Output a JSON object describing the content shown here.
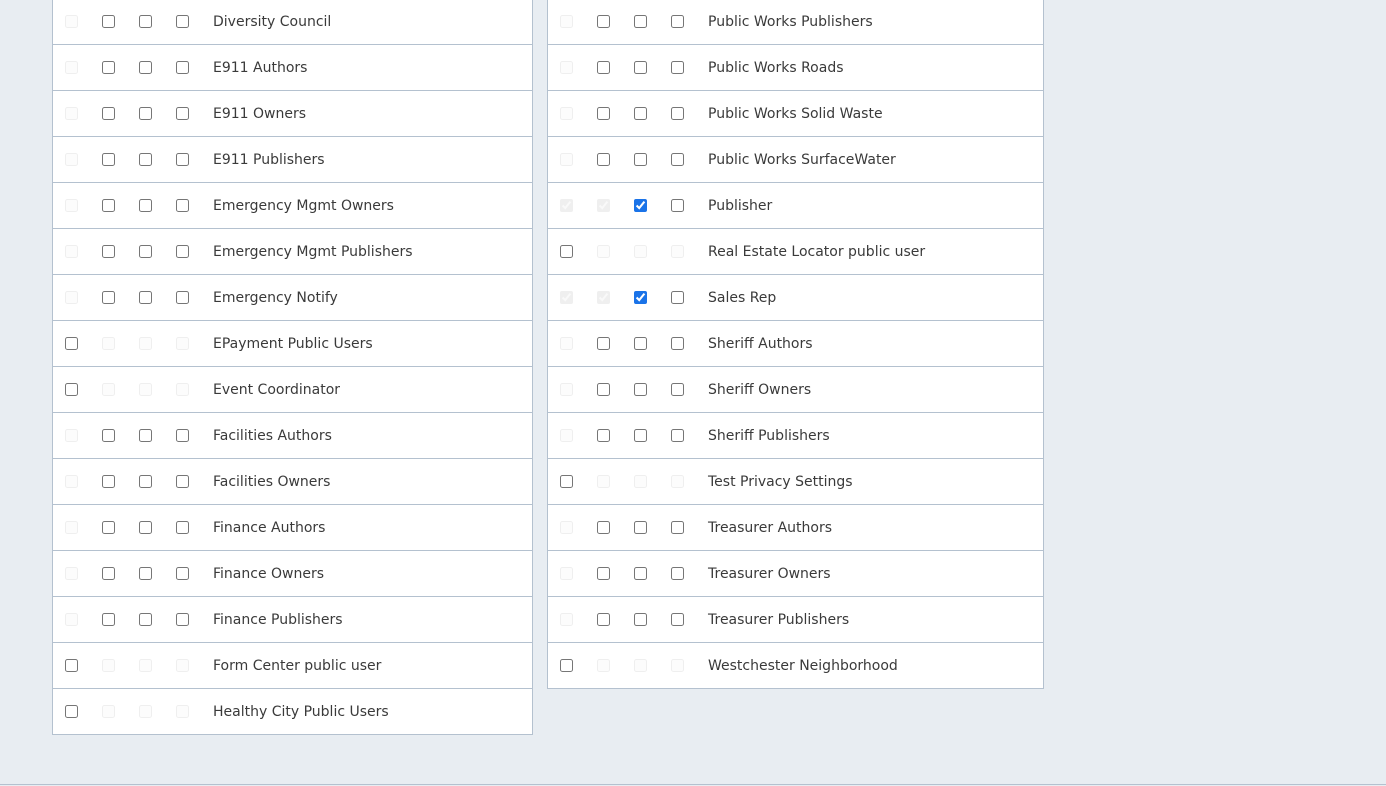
{
  "colors": {
    "page_background": "#e8edf2",
    "table_background": "#ffffff",
    "border": "#b4c1cf",
    "checkbox_checked": "#1a73e8",
    "text": "#3a3a3a"
  },
  "left_table": {
    "rows": [
      {
        "label": "Diversity Council",
        "checks": [
          {
            "checked": false,
            "disabled": true
          },
          {
            "checked": false,
            "disabled": false
          },
          {
            "checked": false,
            "disabled": false
          },
          {
            "checked": false,
            "disabled": false
          }
        ]
      },
      {
        "label": "E911 Authors",
        "checks": [
          {
            "checked": false,
            "disabled": true
          },
          {
            "checked": false,
            "disabled": false
          },
          {
            "checked": false,
            "disabled": false
          },
          {
            "checked": false,
            "disabled": false
          }
        ]
      },
      {
        "label": "E911 Owners",
        "checks": [
          {
            "checked": false,
            "disabled": true
          },
          {
            "checked": false,
            "disabled": false
          },
          {
            "checked": false,
            "disabled": false
          },
          {
            "checked": false,
            "disabled": false
          }
        ]
      },
      {
        "label": "E911 Publishers",
        "checks": [
          {
            "checked": false,
            "disabled": true
          },
          {
            "checked": false,
            "disabled": false
          },
          {
            "checked": false,
            "disabled": false
          },
          {
            "checked": false,
            "disabled": false
          }
        ]
      },
      {
        "label": "Emergency Mgmt Owners",
        "checks": [
          {
            "checked": false,
            "disabled": true
          },
          {
            "checked": false,
            "disabled": false
          },
          {
            "checked": false,
            "disabled": false
          },
          {
            "checked": false,
            "disabled": false
          }
        ]
      },
      {
        "label": "Emergency Mgmt Publishers",
        "checks": [
          {
            "checked": false,
            "disabled": true
          },
          {
            "checked": false,
            "disabled": false
          },
          {
            "checked": false,
            "disabled": false
          },
          {
            "checked": false,
            "disabled": false
          }
        ]
      },
      {
        "label": "Emergency Notify",
        "checks": [
          {
            "checked": false,
            "disabled": true
          },
          {
            "checked": false,
            "disabled": false
          },
          {
            "checked": false,
            "disabled": false
          },
          {
            "checked": false,
            "disabled": false
          }
        ]
      },
      {
        "label": "EPayment Public Users",
        "checks": [
          {
            "checked": false,
            "disabled": false
          },
          {
            "checked": false,
            "disabled": true
          },
          {
            "checked": false,
            "disabled": true
          },
          {
            "checked": false,
            "disabled": true
          }
        ]
      },
      {
        "label": "Event Coordinator",
        "checks": [
          {
            "checked": false,
            "disabled": false
          },
          {
            "checked": false,
            "disabled": true
          },
          {
            "checked": false,
            "disabled": true
          },
          {
            "checked": false,
            "disabled": true
          }
        ]
      },
      {
        "label": "Facilities Authors",
        "checks": [
          {
            "checked": false,
            "disabled": true
          },
          {
            "checked": false,
            "disabled": false
          },
          {
            "checked": false,
            "disabled": false
          },
          {
            "checked": false,
            "disabled": false
          }
        ]
      },
      {
        "label": "Facilities Owners",
        "checks": [
          {
            "checked": false,
            "disabled": true
          },
          {
            "checked": false,
            "disabled": false
          },
          {
            "checked": false,
            "disabled": false
          },
          {
            "checked": false,
            "disabled": false
          }
        ]
      },
      {
        "label": "Finance Authors",
        "checks": [
          {
            "checked": false,
            "disabled": true
          },
          {
            "checked": false,
            "disabled": false
          },
          {
            "checked": false,
            "disabled": false
          },
          {
            "checked": false,
            "disabled": false
          }
        ]
      },
      {
        "label": "Finance Owners",
        "checks": [
          {
            "checked": false,
            "disabled": true
          },
          {
            "checked": false,
            "disabled": false
          },
          {
            "checked": false,
            "disabled": false
          },
          {
            "checked": false,
            "disabled": false
          }
        ]
      },
      {
        "label": "Finance Publishers",
        "checks": [
          {
            "checked": false,
            "disabled": true
          },
          {
            "checked": false,
            "disabled": false
          },
          {
            "checked": false,
            "disabled": false
          },
          {
            "checked": false,
            "disabled": false
          }
        ]
      },
      {
        "label": "Form Center public user",
        "checks": [
          {
            "checked": false,
            "disabled": false
          },
          {
            "checked": false,
            "disabled": true
          },
          {
            "checked": false,
            "disabled": true
          },
          {
            "checked": false,
            "disabled": true
          }
        ]
      },
      {
        "label": "Healthy City Public Users",
        "checks": [
          {
            "checked": false,
            "disabled": false
          },
          {
            "checked": false,
            "disabled": true
          },
          {
            "checked": false,
            "disabled": true
          },
          {
            "checked": false,
            "disabled": true
          }
        ]
      }
    ]
  },
  "right_table": {
    "rows": [
      {
        "label": "Public Works Publishers",
        "checks": [
          {
            "checked": false,
            "disabled": true
          },
          {
            "checked": false,
            "disabled": false
          },
          {
            "checked": false,
            "disabled": false
          },
          {
            "checked": false,
            "disabled": false
          }
        ]
      },
      {
        "label": "Public Works Roads",
        "checks": [
          {
            "checked": false,
            "disabled": true
          },
          {
            "checked": false,
            "disabled": false
          },
          {
            "checked": false,
            "disabled": false
          },
          {
            "checked": false,
            "disabled": false
          }
        ]
      },
      {
        "label": "Public Works Solid Waste",
        "checks": [
          {
            "checked": false,
            "disabled": true
          },
          {
            "checked": false,
            "disabled": false
          },
          {
            "checked": false,
            "disabled": false
          },
          {
            "checked": false,
            "disabled": false
          }
        ]
      },
      {
        "label": "Public Works SurfaceWater",
        "checks": [
          {
            "checked": false,
            "disabled": true
          },
          {
            "checked": false,
            "disabled": false
          },
          {
            "checked": false,
            "disabled": false
          },
          {
            "checked": false,
            "disabled": false
          }
        ]
      },
      {
        "label": "Publisher",
        "checks": [
          {
            "checked": true,
            "disabled": true
          },
          {
            "checked": true,
            "disabled": true
          },
          {
            "checked": true,
            "disabled": false
          },
          {
            "checked": false,
            "disabled": false
          }
        ]
      },
      {
        "label": "Real Estate Locator public user",
        "checks": [
          {
            "checked": false,
            "disabled": false
          },
          {
            "checked": false,
            "disabled": true
          },
          {
            "checked": false,
            "disabled": true
          },
          {
            "checked": false,
            "disabled": true
          }
        ]
      },
      {
        "label": "Sales Rep",
        "checks": [
          {
            "checked": true,
            "disabled": true
          },
          {
            "checked": true,
            "disabled": true
          },
          {
            "checked": true,
            "disabled": false
          },
          {
            "checked": false,
            "disabled": false
          }
        ]
      },
      {
        "label": "Sheriff Authors",
        "checks": [
          {
            "checked": false,
            "disabled": true
          },
          {
            "checked": false,
            "disabled": false
          },
          {
            "checked": false,
            "disabled": false
          },
          {
            "checked": false,
            "disabled": false
          }
        ]
      },
      {
        "label": "Sheriff Owners",
        "checks": [
          {
            "checked": false,
            "disabled": true
          },
          {
            "checked": false,
            "disabled": false
          },
          {
            "checked": false,
            "disabled": false
          },
          {
            "checked": false,
            "disabled": false
          }
        ]
      },
      {
        "label": "Sheriff Publishers",
        "checks": [
          {
            "checked": false,
            "disabled": true
          },
          {
            "checked": false,
            "disabled": false
          },
          {
            "checked": false,
            "disabled": false
          },
          {
            "checked": false,
            "disabled": false
          }
        ]
      },
      {
        "label": "Test Privacy Settings",
        "checks": [
          {
            "checked": false,
            "disabled": false
          },
          {
            "checked": false,
            "disabled": true
          },
          {
            "checked": false,
            "disabled": true
          },
          {
            "checked": false,
            "disabled": true
          }
        ]
      },
      {
        "label": "Treasurer Authors",
        "checks": [
          {
            "checked": false,
            "disabled": true
          },
          {
            "checked": false,
            "disabled": false
          },
          {
            "checked": false,
            "disabled": false
          },
          {
            "checked": false,
            "disabled": false
          }
        ]
      },
      {
        "label": "Treasurer Owners",
        "checks": [
          {
            "checked": false,
            "disabled": true
          },
          {
            "checked": false,
            "disabled": false
          },
          {
            "checked": false,
            "disabled": false
          },
          {
            "checked": false,
            "disabled": false
          }
        ]
      },
      {
        "label": "Treasurer Publishers",
        "checks": [
          {
            "checked": false,
            "disabled": true
          },
          {
            "checked": false,
            "disabled": false
          },
          {
            "checked": false,
            "disabled": false
          },
          {
            "checked": false,
            "disabled": false
          }
        ]
      },
      {
        "label": "Westchester Neighborhood",
        "checks": [
          {
            "checked": false,
            "disabled": false
          },
          {
            "checked": false,
            "disabled": true
          },
          {
            "checked": false,
            "disabled": true
          },
          {
            "checked": false,
            "disabled": true
          }
        ]
      }
    ]
  }
}
